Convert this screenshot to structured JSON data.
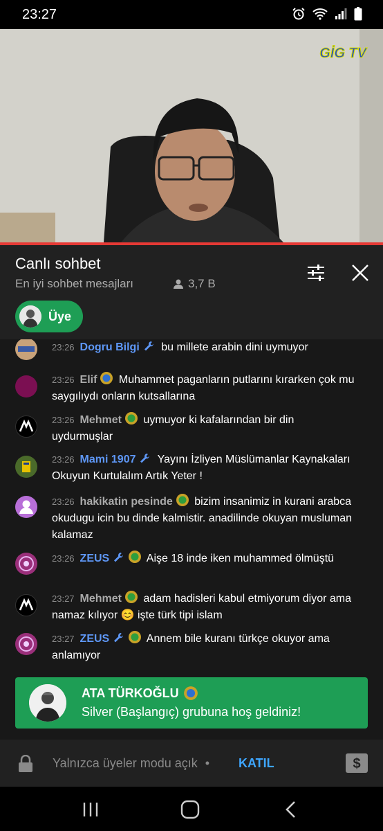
{
  "status_bar": {
    "time": "23:27",
    "icons": [
      "alarm-icon",
      "wifi-icon",
      "signal-icon",
      "battery-icon"
    ]
  },
  "video": {
    "watermark": "GİG TV"
  },
  "chat": {
    "title": "Canlı sohbet",
    "mode": "En iyi sohbet mesajları",
    "viewers": "3,7 B",
    "member_chip_label": "Üye"
  },
  "messages": [
    {
      "time": "23:26",
      "author": "Dogru Bilgi",
      "text": "bu millete arabin dini uymuyor",
      "avatar_color": "#c8a27a"
    },
    {
      "time": "23:26",
      "author": "Elif",
      "text": "Muhammet paganların putlarını kırarken çok mu saygılıydı onların kutsallarına",
      "avatar_color": "#7b0f52"
    },
    {
      "time": "23:26",
      "author": "Mehmet",
      "text": "uymuyor ki kafalarından bir din uydurmuşlar",
      "avatar_color": "#000000"
    },
    {
      "time": "23:26",
      "author": "Mami 1907",
      "text": "Yayını İzliyen Müslümanlar Kaynakaları Okuyun Kurtulalım Artık Yeter !",
      "avatar_color": "#4a6a2a"
    },
    {
      "time": "23:26",
      "author": "hakikatin pesinde",
      "text": "bizim insanimiz in kurani arabca okudugu icin bu dinde kalmistir. anadilinde okuyan musluman kalamaz",
      "avatar_color": "#b86fd8"
    },
    {
      "time": "23:26",
      "author": "ZEUS",
      "text": "Aişe 18 inde iken muhammed ölmüştü",
      "avatar_color": "#9a2f7a"
    },
    {
      "time": "23:27",
      "author": "Mehmet",
      "text": "adam hadisleri kabul etmiyorum diyor ama namaz kılıyor 😊 işte türk tipi islam",
      "avatar_color": "#000000"
    },
    {
      "time": "23:27",
      "author": "ZEUS",
      "text": "Annem bile kuranı türkçe okuyor ama anlamıyor",
      "avatar_color": "#9a2f7a"
    }
  ],
  "welcome": {
    "name": "ATA TÜRKOĞLU",
    "message": "Silver (Başlangıç) grubuna hoş geldiniz!"
  },
  "input": {
    "hint": "Yalnızca üyeler modu açık",
    "separator": "•",
    "join_label": "KATIL"
  },
  "colors": {
    "accent_green": "#1e9e55",
    "link_blue": "#3ea6ff",
    "mod_blue": "#5e97f6",
    "progress_red": "#e53935"
  }
}
